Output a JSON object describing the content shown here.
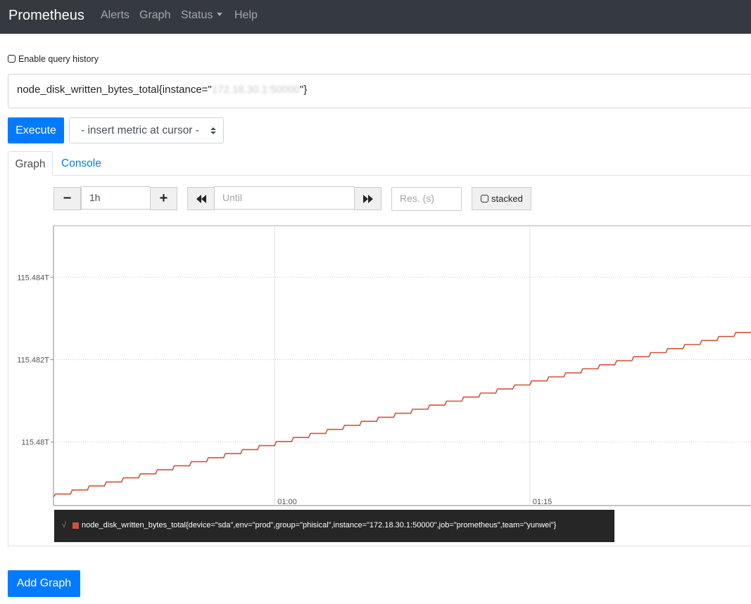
{
  "navbar": {
    "brand": "Prometheus",
    "items": [
      "Alerts",
      "Graph",
      "Status",
      "Help"
    ]
  },
  "history": {
    "label": "Enable query history",
    "checked": false
  },
  "query": {
    "prefix": "node_disk_written_bytes_total{instance=\"",
    "masked": "172.18.30.1:50000",
    "suffix": "\"}"
  },
  "buttons": {
    "execute": "Execute",
    "add_graph": "Add Graph"
  },
  "metric_select": {
    "label": "- insert metric at cursor -"
  },
  "tabs": {
    "graph": "Graph",
    "console": "Console",
    "active": "graph"
  },
  "controls": {
    "minus": "−",
    "range_value": "1h",
    "plus": "+",
    "until_placeholder": "Until",
    "res_placeholder": "Res. (s)",
    "stacked_label": "stacked"
  },
  "colors": {
    "accent": "#007bff",
    "navbar": "#343a40",
    "series": "#d0543a"
  },
  "chart_data": {
    "type": "line",
    "y_ticks": [
      "115.484T",
      "115.482T",
      "115.48T"
    ],
    "x_ticks": [
      "01:00",
      "01:15"
    ],
    "ylim": [
      115.47846,
      115.48525
    ],
    "grid": true,
    "series": [
      {
        "name": "node_disk_written_bytes_total{device=\"sda\",env=\"prod\",group=\"phisical\",instance=\"172.18.30.1:50000\",job=\"prometheus\",team=\"yunwei\"}",
        "start_value": 115.47874,
        "end_value": 115.48266,
        "steps": 41,
        "x_range": [
          "00:47",
          "01:28"
        ]
      }
    ]
  }
}
